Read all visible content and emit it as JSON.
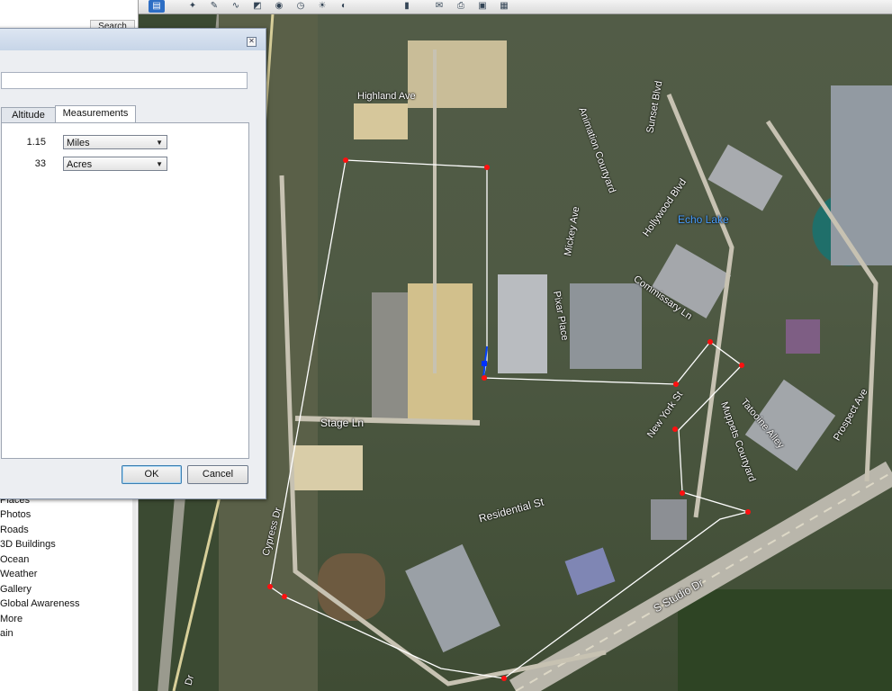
{
  "toolbar": {
    "icons": [
      "sidebar-toggle-icon",
      "placemark-icon",
      "polygon-icon",
      "path-icon",
      "overlay-icon",
      "tour-icon",
      "history-icon",
      "sun-icon",
      "planets-icon",
      "ruler-icon",
      "email-icon",
      "print-icon",
      "save-image-icon",
      "maps-icon"
    ]
  },
  "left_panel": {
    "search_button": "Search",
    "layers": [
      "Places",
      "Photos",
      "Roads",
      "3D Buildings",
      "Ocean",
      "Weather",
      "Gallery",
      "Global Awareness",
      "More",
      "ain"
    ]
  },
  "dialog": {
    "name_value": "",
    "tabs": [
      {
        "label": "Altitude",
        "active": false
      },
      {
        "label": "Measurements",
        "active": true
      }
    ],
    "measurements": [
      {
        "value": "1.15",
        "unit": "Miles"
      },
      {
        "value": "33",
        "unit": "Acres"
      }
    ],
    "ok_label": "OK",
    "cancel_label": "Cancel"
  },
  "map": {
    "streets": [
      "Highland Ave",
      "Sunset Blvd",
      "Animation Courtyard",
      "Hollywood Blvd",
      "Mickey Ave",
      "Commissary Ln",
      "Pixar Place",
      "Stage Ln",
      "New York St",
      "Muppets Courtyard",
      "Tatooine Alley",
      "Prospect Ave",
      "Residential St",
      "Cypress Dr",
      "S Studio Dr",
      "Dr"
    ],
    "water_label": "Echo Lake",
    "accent": "#ff0000"
  }
}
